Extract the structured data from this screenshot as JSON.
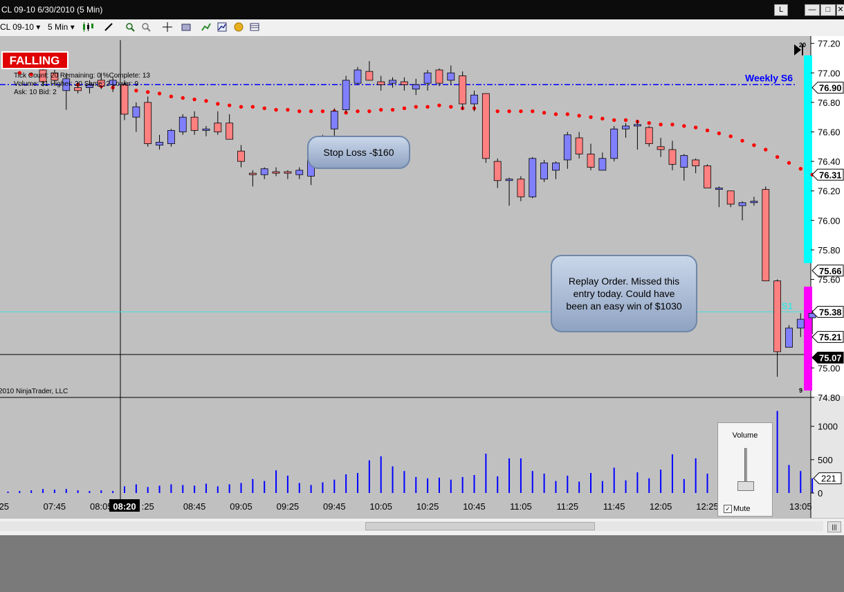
{
  "window": {
    "title": "CL 09-10  6/30/2010 (5 Min)",
    "btn_l": "L",
    "btn_min": "—",
    "btn_max": "□",
    "btn_close": "✕"
  },
  "toolbar": {
    "instrument": "CL 09-10",
    "period": "5 Min",
    "dropdown_glyph": "▾"
  },
  "icons": [
    "candlestick-style-icon",
    "pencil-draw-icon",
    "zoom-in-icon",
    "zoom-out-icon",
    "crosshair-icon",
    "snapshot-icon",
    "indicators-icon",
    "strategies-icon",
    "money-icon",
    "data-box-icon"
  ],
  "overlay": {
    "falling_label": "FALLING",
    "stats_line1": "Tick Count: 20   Remaining: 0   %Complete: 13",
    "stats_line2": "Volume: 31   Higher: 20   Same: 2   Lower: 9",
    "stats_line3": "Ask: 10   Bid: 2",
    "copyright": "2010 NinjaTrader, LLC",
    "weekly_label": "Weekly S6",
    "s1_label": "S1",
    "top_count": "20",
    "bottom_count": "9"
  },
  "callouts": {
    "stop_loss": "Stop Loss -$160",
    "replay": "Replay Order. Missed this entry today. Could have been an easy win of $1030"
  },
  "volume_panel": {
    "title": "Volume",
    "mute_label": "Mute",
    "mute_check": "✓"
  },
  "colors": {
    "bull": "#8080ff",
    "bear": "#ff8080",
    "background": "#c0c0c0",
    "sar_dot": "#ff0000",
    "weekly_line": "#0000ff",
    "volume_bar": "#0000ff",
    "cyan_bar": "#00ffff",
    "magenta_bar": "#ff00ff"
  },
  "chart_data": [
    {
      "type": "candlestick",
      "title": "CL 09-10 6/30/2010 (5 Min)",
      "ylim": [
        74.8,
        77.25
      ],
      "y_ticks": [
        77.2,
        77.0,
        76.8,
        76.6,
        76.4,
        76.2,
        76.0,
        75.8,
        75.6,
        75.0,
        74.8
      ],
      "y_tick_labels": [
        "77.20",
        "77.00",
        "76.80",
        "76.60",
        "76.40",
        "76.20",
        "76.00",
        "75.80",
        "75.60",
        "75.00",
        "74.80"
      ],
      "price_markers": [
        {
          "label": "76.90",
          "value": 76.9,
          "style": "outline"
        },
        {
          "label": "76.31",
          "value": 76.31,
          "style": "outline"
        },
        {
          "label": "75.66",
          "value": 75.66,
          "style": "outline"
        },
        {
          "label": "75.38",
          "value": 75.38,
          "style": "outline"
        },
        {
          "label": "75.21",
          "value": 75.21,
          "style": "outline"
        },
        {
          "label": "75.07",
          "value": 75.07,
          "style": "filled"
        }
      ],
      "x_labels": [
        ":25",
        "07:45",
        "08:05",
        "08:20",
        ":25",
        "08:45",
        "09:05",
        "09:25",
        "09:45",
        "10:05",
        "10:25",
        "10:45",
        "11:05",
        "11:25",
        "11:45",
        "12:05",
        "12:25",
        "13:05"
      ],
      "x_label_slots": [
        0,
        4,
        8,
        10,
        12,
        16,
        20,
        24,
        28,
        32,
        36,
        40,
        44,
        48,
        52,
        56,
        60,
        68
      ],
      "current_time_label": "08:20",
      "weekly_s6": 76.92,
      "s1_level": 75.38,
      "candles": [
        {
          "o": 77.12,
          "h": 77.14,
          "l": 77.05,
          "c": 77.08
        },
        {
          "o": 77.12,
          "h": 77.13,
          "l": 77.08,
          "c": 77.12
        },
        {
          "o": 77.1,
          "h": 77.12,
          "l": 77.03,
          "c": 77.06
        },
        {
          "o": 77.02,
          "h": 77.1,
          "l": 76.91,
          "c": 76.94
        },
        {
          "o": 77.0,
          "h": 77.02,
          "l": 76.92,
          "c": 76.95
        },
        {
          "o": 76.88,
          "h": 77.0,
          "l": 76.75,
          "c": 76.96
        },
        {
          "o": 76.9,
          "h": 76.94,
          "l": 76.86,
          "c": 76.88
        },
        {
          "o": 76.9,
          "h": 76.95,
          "l": 76.86,
          "c": 76.92
        },
        {
          "o": 76.95,
          "h": 77.0,
          "l": 76.89,
          "c": 76.91
        },
        {
          "o": 76.92,
          "h": 76.97,
          "l": 76.87,
          "c": 76.95
        },
        {
          "o": 76.92,
          "h": 76.95,
          "l": 76.68,
          "c": 76.72
        },
        {
          "o": 76.7,
          "h": 76.8,
          "l": 76.6,
          "c": 76.77
        },
        {
          "o": 76.8,
          "h": 76.84,
          "l": 76.5,
          "c": 76.52
        },
        {
          "o": 76.51,
          "h": 76.58,
          "l": 76.48,
          "c": 76.53
        },
        {
          "o": 76.52,
          "h": 76.62,
          "l": 76.5,
          "c": 76.61
        },
        {
          "o": 76.6,
          "h": 76.72,
          "l": 76.58,
          "c": 76.7
        },
        {
          "o": 76.7,
          "h": 76.74,
          "l": 76.58,
          "c": 76.61
        },
        {
          "o": 76.61,
          "h": 76.64,
          "l": 76.57,
          "c": 76.62
        },
        {
          "o": 76.66,
          "h": 76.74,
          "l": 76.58,
          "c": 76.6
        },
        {
          "o": 76.66,
          "h": 76.72,
          "l": 76.55,
          "c": 76.55
        },
        {
          "o": 76.47,
          "h": 76.51,
          "l": 76.36,
          "c": 76.4
        },
        {
          "o": 76.32,
          "h": 76.34,
          "l": 76.23,
          "c": 76.31
        },
        {
          "o": 76.31,
          "h": 76.36,
          "l": 76.28,
          "c": 76.35
        },
        {
          "o": 76.33,
          "h": 76.36,
          "l": 76.3,
          "c": 76.32
        },
        {
          "o": 76.33,
          "h": 76.34,
          "l": 76.28,
          "c": 76.32
        },
        {
          "o": 76.31,
          "h": 76.36,
          "l": 76.28,
          "c": 76.34
        },
        {
          "o": 76.3,
          "h": 76.48,
          "l": 76.24,
          "c": 76.44
        },
        {
          "o": 76.45,
          "h": 76.58,
          "l": 76.4,
          "c": 76.55
        },
        {
          "o": 76.62,
          "h": 76.76,
          "l": 76.56,
          "c": 76.74
        },
        {
          "o": 76.75,
          "h": 76.98,
          "l": 76.73,
          "c": 76.95
        },
        {
          "o": 76.93,
          "h": 77.04,
          "l": 76.92,
          "c": 77.02
        },
        {
          "o": 77.01,
          "h": 77.08,
          "l": 76.95,
          "c": 76.95
        },
        {
          "o": 76.94,
          "h": 76.98,
          "l": 76.88,
          "c": 76.92
        },
        {
          "o": 76.93,
          "h": 76.97,
          "l": 76.9,
          "c": 76.95
        },
        {
          "o": 76.94,
          "h": 76.97,
          "l": 76.88,
          "c": 76.92
        },
        {
          "o": 76.89,
          "h": 76.96,
          "l": 76.85,
          "c": 76.92
        },
        {
          "o": 76.93,
          "h": 77.02,
          "l": 76.88,
          "c": 77.0
        },
        {
          "o": 77.02,
          "h": 77.03,
          "l": 76.91,
          "c": 76.93
        },
        {
          "o": 76.95,
          "h": 77.05,
          "l": 76.92,
          "c": 77.0
        },
        {
          "o": 76.98,
          "h": 77.01,
          "l": 76.75,
          "c": 76.79
        },
        {
          "o": 76.79,
          "h": 76.88,
          "l": 76.74,
          "c": 76.85
        },
        {
          "o": 76.86,
          "h": 76.86,
          "l": 76.39,
          "c": 76.42
        },
        {
          "o": 76.4,
          "h": 76.42,
          "l": 76.22,
          "c": 76.27
        },
        {
          "o": 76.27,
          "h": 76.29,
          "l": 76.1,
          "c": 76.28
        },
        {
          "o": 76.28,
          "h": 76.3,
          "l": 76.13,
          "c": 76.16
        },
        {
          "o": 76.16,
          "h": 76.43,
          "l": 76.15,
          "c": 76.42
        },
        {
          "o": 76.28,
          "h": 76.41,
          "l": 76.26,
          "c": 76.39
        },
        {
          "o": 76.34,
          "h": 76.4,
          "l": 76.28,
          "c": 76.39
        },
        {
          "o": 76.41,
          "h": 76.6,
          "l": 76.35,
          "c": 76.58
        },
        {
          "o": 76.56,
          "h": 76.6,
          "l": 76.42,
          "c": 76.45
        },
        {
          "o": 76.45,
          "h": 76.52,
          "l": 76.34,
          "c": 76.36
        },
        {
          "o": 76.34,
          "h": 76.46,
          "l": 76.34,
          "c": 76.42
        },
        {
          "o": 76.42,
          "h": 76.64,
          "l": 76.4,
          "c": 76.62
        },
        {
          "o": 76.62,
          "h": 76.66,
          "l": 76.56,
          "c": 76.64
        },
        {
          "o": 76.64,
          "h": 76.68,
          "l": 76.48,
          "c": 76.65
        },
        {
          "o": 76.63,
          "h": 76.64,
          "l": 76.5,
          "c": 76.52
        },
        {
          "o": 76.5,
          "h": 76.56,
          "l": 76.43,
          "c": 76.48
        },
        {
          "o": 76.48,
          "h": 76.54,
          "l": 76.34,
          "c": 76.38
        },
        {
          "o": 76.36,
          "h": 76.45,
          "l": 76.27,
          "c": 76.44
        },
        {
          "o": 76.41,
          "h": 76.42,
          "l": 76.32,
          "c": 76.37
        },
        {
          "o": 76.37,
          "h": 76.38,
          "l": 76.22,
          "c": 76.22
        },
        {
          "o": 76.21,
          "h": 76.23,
          "l": 76.09,
          "c": 76.22
        },
        {
          "o": 76.2,
          "h": 76.2,
          "l": 76.09,
          "c": 76.11
        },
        {
          "o": 76.1,
          "h": 76.13,
          "l": 76.0,
          "c": 76.12
        },
        {
          "o": 76.12,
          "h": 76.16,
          "l": 76.1,
          "c": 76.13
        },
        {
          "o": 76.21,
          "h": 76.23,
          "l": 75.59,
          "c": 75.59
        },
        {
          "o": 75.59,
          "h": 75.6,
          "l": 74.94,
          "c": 75.11
        },
        {
          "o": 75.14,
          "h": 75.29,
          "l": 75.14,
          "c": 75.27
        },
        {
          "o": 75.27,
          "h": 75.37,
          "l": 75.21,
          "c": 75.33
        },
        {
          "o": 75.34,
          "h": 75.39,
          "l": 75.23,
          "c": 75.37
        }
      ],
      "sar": [
        77.0,
        76.99,
        76.97,
        76.96,
        76.94,
        76.92,
        76.91,
        76.91,
        76.9,
        76.89,
        76.88,
        76.87,
        76.86,
        76.84,
        76.83,
        76.82,
        76.81,
        76.79,
        76.78,
        76.77,
        76.77,
        76.76,
        76.75,
        76.75,
        76.74,
        76.74,
        76.74,
        76.74,
        76.73,
        76.74,
        76.74,
        76.75,
        76.75,
        76.76,
        76.77,
        76.77,
        76.78,
        76.77,
        76.76,
        76.76,
        76.74,
        76.74,
        76.74,
        76.74,
        76.74,
        76.73,
        76.72,
        76.72,
        76.71,
        76.7,
        76.69,
        76.68,
        76.68,
        76.67,
        76.66,
        76.65,
        76.65,
        76.64,
        76.63,
        76.61,
        76.59,
        76.57,
        76.54,
        76.51,
        76.48,
        76.43,
        76.39,
        76.35,
        76.31
      ]
    },
    {
      "type": "bar",
      "title": "Volume",
      "ylim": [
        0,
        1350
      ],
      "y_ticks": [
        0,
        500,
        1000
      ],
      "y_tick_labels": [
        "0",
        "500",
        "1000"
      ],
      "last_value_label": "221",
      "values": [
        20,
        30,
        40,
        60,
        50,
        60,
        40,
        30,
        40,
        30,
        100,
        130,
        90,
        110,
        130,
        120,
        110,
        140,
        100,
        130,
        150,
        210,
        180,
        340,
        260,
        150,
        120,
        160,
        200,
        280,
        300,
        490,
        550,
        400,
        330,
        240,
        220,
        230,
        200,
        240,
        270,
        590,
        250,
        520,
        520,
        330,
        290,
        180,
        260,
        170,
        300,
        180,
        380,
        190,
        310,
        220,
        350,
        580,
        210,
        520,
        290,
        350,
        270,
        190,
        120,
        260,
        1230,
        420,
        330,
        221
      ]
    }
  ]
}
